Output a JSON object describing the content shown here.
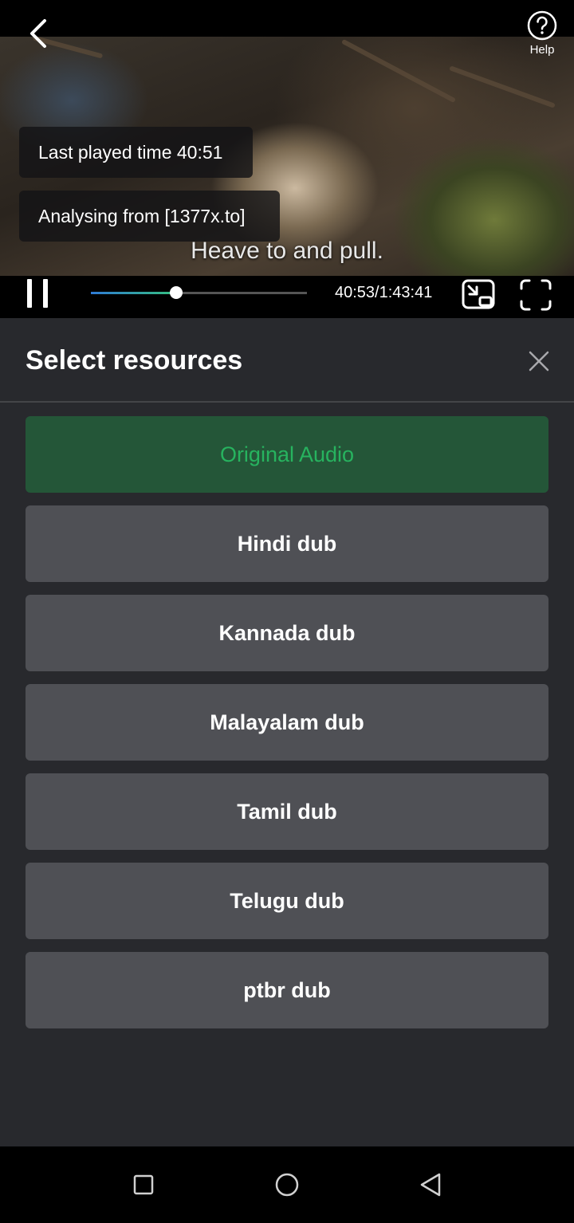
{
  "player": {
    "help_label": "Help",
    "toasts": {
      "last_played": "Last played time 40:51",
      "analysing": "Analysing from [1377x.to]"
    },
    "subtitle": "Heave to and pull.",
    "time_display": "40:53/1:43:41",
    "progress_fraction": 0.394,
    "icons": {
      "back": "chevron-left-icon",
      "help": "question-circle-icon",
      "pause": "pause-icon",
      "pip": "picture-in-picture-icon",
      "fullscreen": "fullscreen-icon"
    }
  },
  "sheet": {
    "title": "Select resources",
    "close_icon": "close-icon",
    "options": [
      {
        "label": "Original Audio",
        "selected": true
      },
      {
        "label": "Hindi dub",
        "selected": false
      },
      {
        "label": "Kannada dub",
        "selected": false
      },
      {
        "label": "Malayalam dub",
        "selected": false
      },
      {
        "label": "Tamil dub",
        "selected": false
      },
      {
        "label": "Telugu dub",
        "selected": false
      },
      {
        "label": "ptbr dub",
        "selected": false
      }
    ]
  },
  "nav": {
    "icons": [
      "square-recents-icon",
      "circle-home-icon",
      "triangle-back-icon"
    ]
  },
  "colors": {
    "sheet_bg": "#28292d",
    "option_bg": "#4f5055",
    "selected_bg": "#245638",
    "selected_text": "#27b35f",
    "progress_start": "#2f7bd6",
    "progress_end": "#35c07f"
  }
}
